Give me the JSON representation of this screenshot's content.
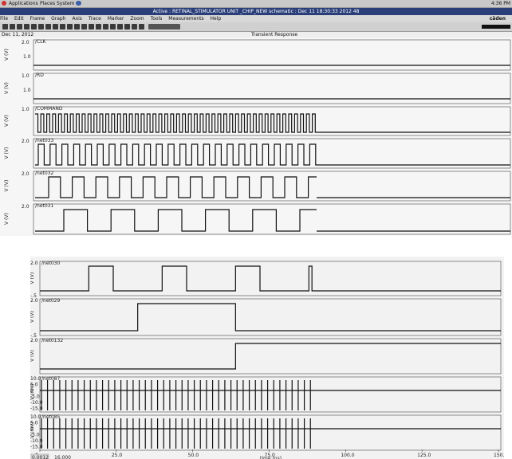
{
  "screenshot1": {
    "topbar": {
      "menus": [
        "Applications",
        "Places",
        "System"
      ],
      "clock": "4:36 PM"
    },
    "window_title": "Active : RETINAL_STIMULATOR UNIT _CHIP_NEW schematic : Dec 11 18:30:33 2012 48",
    "menus": [
      "File",
      "Edit",
      "Frame",
      "Graph",
      "Axis",
      "Trace",
      "Marker",
      "Zoom",
      "Tools",
      "Measurements",
      "Help"
    ],
    "brand": "cāden",
    "date": "Dec 11, 2012",
    "plot_title": "Transient Response",
    "signals": [
      {
        "name": "/CLK",
        "ytop": "2.0",
        "ymid": "1.0",
        "ylabel": "V (V)"
      },
      {
        "name": "/RD",
        "ytop": "1.0",
        "ymid": "1.0",
        "ylabel": "V (V)"
      },
      {
        "name": "/COMMAND",
        "ytop": "1.0",
        "ymid": "",
        "ylabel": "V (V)"
      },
      {
        "name": "/net033",
        "ytop": "2.0",
        "ymid": "",
        "ylabel": "V (V)"
      },
      {
        "name": "/net032",
        "ytop": "2.0",
        "ymid": "",
        "ylabel": "V (V)"
      },
      {
        "name": "/net031",
        "ytop": "2.0",
        "ymid": "",
        "ylabel": "V (V)"
      }
    ]
  },
  "screenshot2": {
    "signals": [
      {
        "name": "/net030",
        "ytop": "2.0",
        "ybot": "-.5",
        "ylabel": "V (V)"
      },
      {
        "name": "/net029",
        "ytop": "2.0",
        "ybot": "-.5",
        "ylabel": "V (V)"
      },
      {
        "name": "/net0132",
        "ytop": "2.0",
        "ybot": "",
        "ylabel": "V (V)"
      },
      {
        "name": "/net087",
        "ticks": [
          "10.0",
          "5.0",
          "0",
          "-5.0",
          "-10.0",
          "-15.0"
        ],
        "ylabel": "V (mV)"
      },
      {
        "name": "/net085",
        "ticks": [
          "10.0",
          "5.0",
          "0",
          "-5.0",
          "-10.0",
          "-15.0"
        ],
        "ylabel": "V (mV)"
      }
    ],
    "xaxis": {
      "label": "time (ns)",
      "ticks": [
        "0",
        "25.0",
        "50.0",
        "75.0",
        "100.0",
        "125.0",
        "150.0"
      ]
    },
    "readout": [
      "0.0012",
      "16.000"
    ]
  }
}
